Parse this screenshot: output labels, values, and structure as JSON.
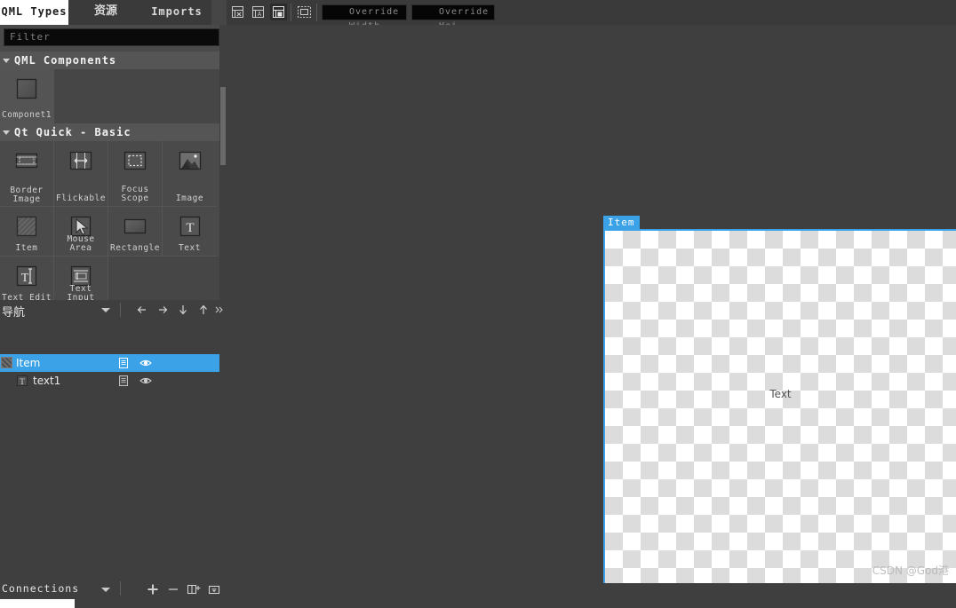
{
  "tabs": [
    {
      "label": "QML Types",
      "active": true
    },
    {
      "label": "资源",
      "active": false
    },
    {
      "label": "Imports",
      "active": false
    }
  ],
  "toolbar": {
    "buttons": [
      {
        "name": "align-reset-icon",
        "label": "reset-size-icon",
        "active": false
      },
      {
        "name": "align-anchor-icon",
        "label": "anchor-icon",
        "active": false
      },
      {
        "name": "align-fill-icon",
        "label": "fill-icon",
        "active": true
      },
      {
        "name": "select-frame-icon",
        "label": "marquee-icon",
        "active": false
      }
    ],
    "override_width": "Override Width",
    "override_height": "Override Hei⋯"
  },
  "library": {
    "filter_placeholder": "Filter",
    "sections": [
      {
        "title": "QML Components",
        "expanded": true,
        "items": [
          {
            "label": "Componet1",
            "icon": "rectangle-thumb-icon",
            "highlight": true
          }
        ]
      },
      {
        "title": "Qt Quick - Basic",
        "expanded": true,
        "items": [
          {
            "label": "Border\nImage",
            "icon": "border-image-icon"
          },
          {
            "label": "Flickable",
            "icon": "flickable-icon"
          },
          {
            "label": "Focus Scope",
            "icon": "focus-scope-icon"
          },
          {
            "label": "Image",
            "icon": "image-icon"
          },
          {
            "label": "Item",
            "icon": "item-icon"
          },
          {
            "label": "Mouse Area",
            "icon": "mouse-area-icon"
          },
          {
            "label": "Rectangle",
            "icon": "rectangle-icon"
          },
          {
            "label": "Text",
            "icon": "text-icon"
          },
          {
            "label": "Text Edit",
            "icon": "text-edit-icon"
          },
          {
            "label": "Text Input",
            "icon": "text-input-icon"
          }
        ]
      }
    ]
  },
  "navigator": {
    "title": "导航",
    "buttons": [
      {
        "name": "nav-back-button",
        "icon": "arrow-left-icon"
      },
      {
        "name": "nav-forward-button",
        "icon": "arrow-right-icon"
      },
      {
        "name": "nav-move-down-button",
        "icon": "arrow-down-icon"
      },
      {
        "name": "nav-move-up-button",
        "icon": "arrow-up-icon"
      },
      {
        "name": "nav-more-button",
        "icon": "chevron-double-right-icon"
      }
    ],
    "rows": [
      {
        "label": "Item",
        "selected": true,
        "indent": 0,
        "type_icon": "item-hatch-icon",
        "has_checkbox": true
      },
      {
        "label": "text1",
        "selected": false,
        "indent": 1,
        "type_icon": "text-type-icon",
        "has_checkbox": false
      }
    ],
    "row_actions": [
      {
        "name": "export-icon"
      },
      {
        "name": "eye-visibility-icon"
      }
    ]
  },
  "connections": {
    "title": "Connections",
    "buttons": [
      {
        "name": "add-connection-button",
        "icon": "plus-icon"
      },
      {
        "name": "remove-connection-button",
        "icon": "minus-icon"
      },
      {
        "name": "split-view-button",
        "icon": "split-plus-icon"
      },
      {
        "name": "panel-options-button",
        "icon": "dropdown-box-icon"
      }
    ]
  },
  "canvas": {
    "item_tag": "Item",
    "text_element": "Text"
  },
  "watermark": "CSDN @God港",
  "colors": {
    "accent": "#3ba2e8",
    "panel": "#4a4a4a",
    "background": "#3f3f3f",
    "section_header": "#555555",
    "tab_active_bg": "#ffffff",
    "checker_light": "#ffffff",
    "checker_dark": "#dcdcdc"
  }
}
